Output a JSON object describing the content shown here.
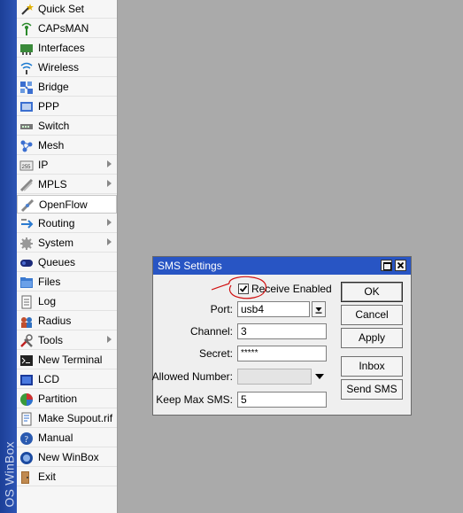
{
  "sidebar": {
    "brand": "OS WinBox",
    "items": [
      {
        "label": "Quick Set",
        "icon": "magic-wand-icon"
      },
      {
        "label": "CAPsMAN",
        "icon": "antenna-icon"
      },
      {
        "label": "Interfaces",
        "icon": "network-card-icon"
      },
      {
        "label": "Wireless",
        "icon": "wireless-icon"
      },
      {
        "label": "Bridge",
        "icon": "bridge-icon"
      },
      {
        "label": "PPP",
        "icon": "ppp-icon"
      },
      {
        "label": "Switch",
        "icon": "switch-icon"
      },
      {
        "label": "Mesh",
        "icon": "mesh-icon"
      },
      {
        "label": "IP",
        "icon": "ip-icon",
        "submenu": true
      },
      {
        "label": "MPLS",
        "icon": "mpls-icon",
        "submenu": true
      },
      {
        "label": "OpenFlow",
        "icon": "openflow-icon",
        "selected": true
      },
      {
        "label": "Routing",
        "icon": "routing-icon",
        "submenu": true
      },
      {
        "label": "System",
        "icon": "gear-icon",
        "submenu": true
      },
      {
        "label": "Queues",
        "icon": "queues-icon"
      },
      {
        "label": "Files",
        "icon": "folder-icon"
      },
      {
        "label": "Log",
        "icon": "log-icon"
      },
      {
        "label": "Radius",
        "icon": "radius-icon"
      },
      {
        "label": "Tools",
        "icon": "tools-icon",
        "submenu": true
      },
      {
        "label": "New Terminal",
        "icon": "terminal-icon"
      },
      {
        "label": "LCD",
        "icon": "lcd-icon"
      },
      {
        "label": "Partition",
        "icon": "partition-icon"
      },
      {
        "label": "Make Supout.rif",
        "icon": "supout-icon"
      },
      {
        "label": "Manual",
        "icon": "manual-icon"
      },
      {
        "label": "New WinBox",
        "icon": "winbox-icon"
      },
      {
        "label": "Exit",
        "icon": "exit-icon"
      }
    ]
  },
  "dialog": {
    "title": "SMS Settings",
    "receive_enabled": {
      "label": "Receive Enabled",
      "checked": true
    },
    "port": {
      "label": "Port:",
      "value": "usb4"
    },
    "channel": {
      "label": "Channel:",
      "value": "3"
    },
    "secret": {
      "label": "Secret:",
      "value": "*****"
    },
    "allowed_number": {
      "label": "Allowed Number:",
      "value": ""
    },
    "keep_max_sms": {
      "label": "Keep Max SMS:",
      "value": "5"
    },
    "buttons": {
      "ok": "OK",
      "cancel": "Cancel",
      "apply": "Apply",
      "inbox": "Inbox",
      "send_sms": "Send SMS"
    }
  },
  "colors": {
    "titlebar": "#2855c4",
    "strip": "#1c3f97",
    "annotation": "#d01010"
  }
}
